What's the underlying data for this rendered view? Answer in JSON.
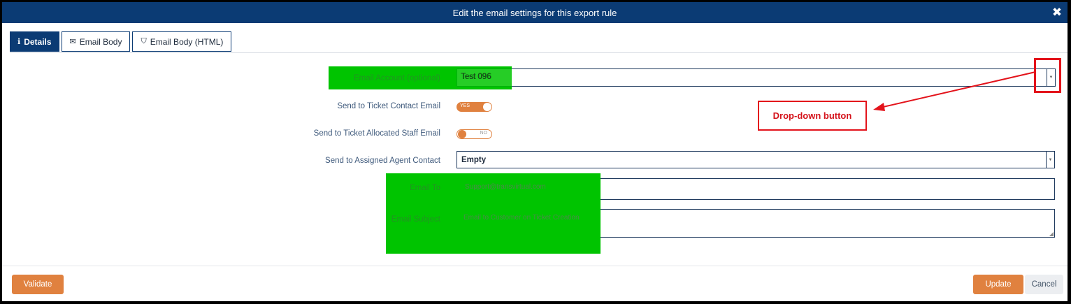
{
  "dialog": {
    "title": "Edit the email settings for this export rule",
    "close_icon": "close-icon"
  },
  "tabs": [
    {
      "label": "Details",
      "icon": "info-icon",
      "glyph": "ℹ",
      "active": true
    },
    {
      "label": "Email Body",
      "icon": "envelope-icon",
      "glyph": "✉",
      "active": false
    },
    {
      "label": "Email Body (HTML)",
      "icon": "html5-icon",
      "glyph": "⛉",
      "active": false
    }
  ],
  "form": {
    "email_account": {
      "label": "Email Account (optional)",
      "value": "Test 096"
    },
    "send_to_ticket_contact": {
      "label": "Send to Ticket Contact Email",
      "state": "YES"
    },
    "send_to_allocated_staff": {
      "label": "Send to Ticket Allocated Staff Email",
      "state": "NO"
    },
    "assigned_agent_contact": {
      "label": "Send to Assigned Agent Contact",
      "value": "Empty"
    },
    "email_to": {
      "label": "Email To",
      "value": "Support@transvirtual.com"
    },
    "email_subject": {
      "label": "Email Subject",
      "value": "Email to Customer on Ticket Creation"
    }
  },
  "footer": {
    "validate_label": "Validate",
    "update_label": "Update",
    "cancel_label": "Cancel"
  },
  "annotation": {
    "callout_text": "Drop-down button",
    "color": "#e3131b"
  },
  "colors": {
    "header": "#0b3b74",
    "accent": "#e0813f",
    "highlight": "#00c400"
  }
}
